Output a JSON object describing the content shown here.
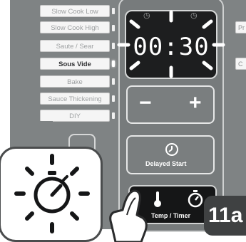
{
  "colors": {
    "panel": "#7f8384",
    "display": "#1d1e1f",
    "button_active": "#151617",
    "badge": "#3f4142"
  },
  "modes": [
    {
      "label": "Slow Cook Low",
      "active": false
    },
    {
      "label": "Slow Cook High",
      "active": false
    },
    {
      "label": "Saute / Sear",
      "active": false
    },
    {
      "label": "Sous Vide",
      "active": true
    },
    {
      "label": "Bake",
      "active": false
    },
    {
      "label": "Sauce Thickening",
      "active": false
    },
    {
      "label": "DIY",
      "active": false
    }
  ],
  "right_labels": [
    "Pr",
    "C"
  ],
  "display": {
    "time": "00:30"
  },
  "controls": {
    "minus": "−",
    "plus": "+",
    "delayed_start": "Delayed Start",
    "temp_timer": "Temp / Timer"
  },
  "badge": "11a",
  "icons": [
    "timer-icon",
    "thermometer-icon",
    "stopwatch-icon",
    "clock-icon",
    "hand-pointer-icon"
  ]
}
